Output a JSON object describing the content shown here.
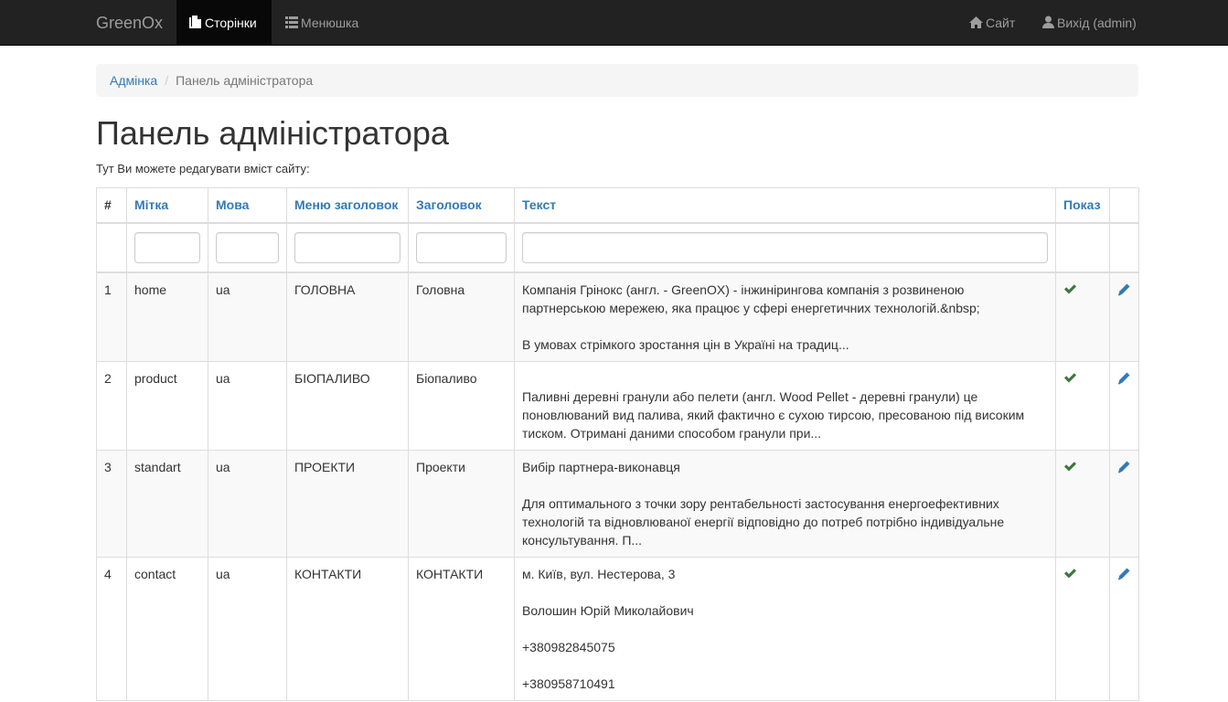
{
  "navbar": {
    "brand": "GreenOx",
    "pages_label": "Сторінки",
    "menu_label": "Менюшка",
    "site_label": "Сайт",
    "logout_label": "Вихід (admin)"
  },
  "breadcrumb": {
    "home": "Адмінка",
    "current": "Панель адміністратора"
  },
  "page": {
    "title": "Панель адміністратора",
    "intro": "Тут Ви можете редагувати вміст сайту:"
  },
  "table": {
    "headers": {
      "num": "#",
      "tag": "Мітка",
      "lang": "Мова",
      "menu_title": "Меню заголовок",
      "title": "Заголовок",
      "text": "Текст",
      "show": "Показ"
    },
    "rows": [
      {
        "num": "1",
        "tag": "home",
        "lang": "ua",
        "menu_title": "ГОЛОВНА",
        "title": "Головна",
        "text": [
          "Компанія Грінокс (англ. - GreenOX) - інжинірингова компанія з розвиненою партнерською мережею, яка працює у сфері енергетичних технологій.&nbsp;",
          "В умовах стрімкого зростання цін в Україні на традиц..."
        ]
      },
      {
        "num": "2",
        "tag": "product",
        "lang": "ua",
        "menu_title": "БІОПАЛИВО",
        "title": "Біопаливо",
        "text": [
          "",
          "Паливні деревні гранули або пелети (англ. Wood Pellet - деревні гранули) це поновлюваний вид палива, який фактично є сухою тирсою, пресованою під високим тиском. Отримані даними способом гранули при..."
        ]
      },
      {
        "num": "3",
        "tag": "standart",
        "lang": "ua",
        "menu_title": "ПРОЕКТИ",
        "title": "Проекти",
        "text": [
          "Вибір партнера-виконавця",
          "Для оптимального з точки зору рентабельності застосування енергоефективних технологій та відновлюваної енергії відповідно до потреб потрібно індивідуальне консультування. П..."
        ]
      },
      {
        "num": "4",
        "tag": "contact",
        "lang": "ua",
        "menu_title": "КОНТАКТИ",
        "title": "КОНТАКТИ",
        "text": [
          "м. Київ, вул. Нестерова, 3",
          "Волошин Юрій Миколайович",
          "+380982845075",
          "+380958710491"
        ]
      }
    ]
  },
  "colors": {
    "navbar_bg": "#222222",
    "link": "#337ab7",
    "check": "#3c763d"
  }
}
